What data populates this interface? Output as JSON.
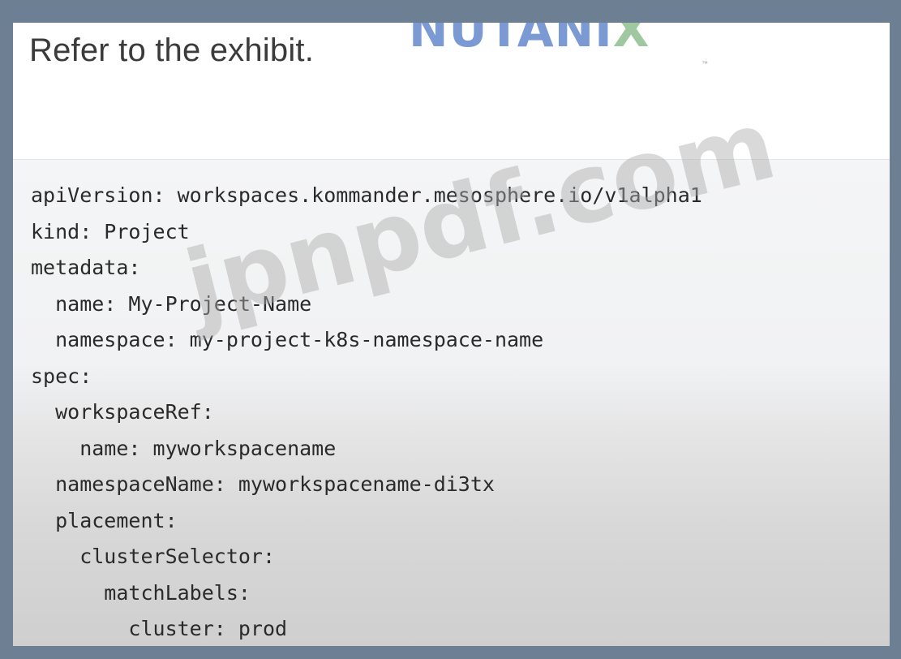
{
  "heading": "Refer to the exhibit.",
  "logo": {
    "text_main": "NUTANI",
    "text_x": "X",
    "trademark": "™"
  },
  "code_lines": [
    "apiVersion: workspaces.kommander.mesosphere.io/v1alpha1",
    "kind: Project",
    "metadata:",
    "  name: My-Project-Name",
    "  namespace: my-project-k8s-namespace-name",
    "spec:",
    "  workspaceRef:",
    "    name: myworkspacename",
    "  namespaceName: myworkspacename-di3tx",
    "  placement:",
    "    clusterSelector:",
    "      matchLabels:",
    "        cluster: prod"
  ],
  "watermark": "jpnpdf.com",
  "colors": {
    "outer_border": "#6d7f93",
    "logo_blue": "#7b9ad3",
    "logo_green": "#9fc8a0"
  }
}
